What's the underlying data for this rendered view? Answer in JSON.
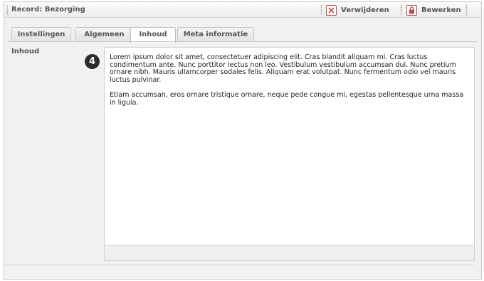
{
  "titlebar": {
    "title": "Record: Bezorging",
    "delete_label": "Verwijderen",
    "edit_label": "Bewerken"
  },
  "tabs": [
    {
      "label": "Instellingen",
      "active": false
    },
    {
      "label": "Algemeen",
      "active": false
    },
    {
      "label": "Inhoud",
      "active": true
    },
    {
      "label": "Meta informatie",
      "active": false
    }
  ],
  "form": {
    "field_label": "Inhoud",
    "step_badge": "4",
    "paragraphs": [
      "Lorem ipsum dolor sit amet, consectetuer adipiscing elit. Cras blandit aliquam mi. Cras luctus condimentum ante. Nunc porttitor lectus non leo. Vestibulum vestibulum accumsan dui. Nunc pretium ornare nibh. Mauris ullamcorper sodales felis. Aliquam erat volutpat. Nunc fermentum odio vel mauris luctus pulvinar.",
      "Etiam accumsan, eros ornare tristique ornare, neque pede congue mi, egestas pellentesque urna massa in ligula."
    ]
  },
  "icons": {
    "delete": "delete-x-icon",
    "edit": "lock-icon"
  },
  "colors": {
    "accent_red": "#c24a4a",
    "panel_bg": "#f1f1f1"
  }
}
